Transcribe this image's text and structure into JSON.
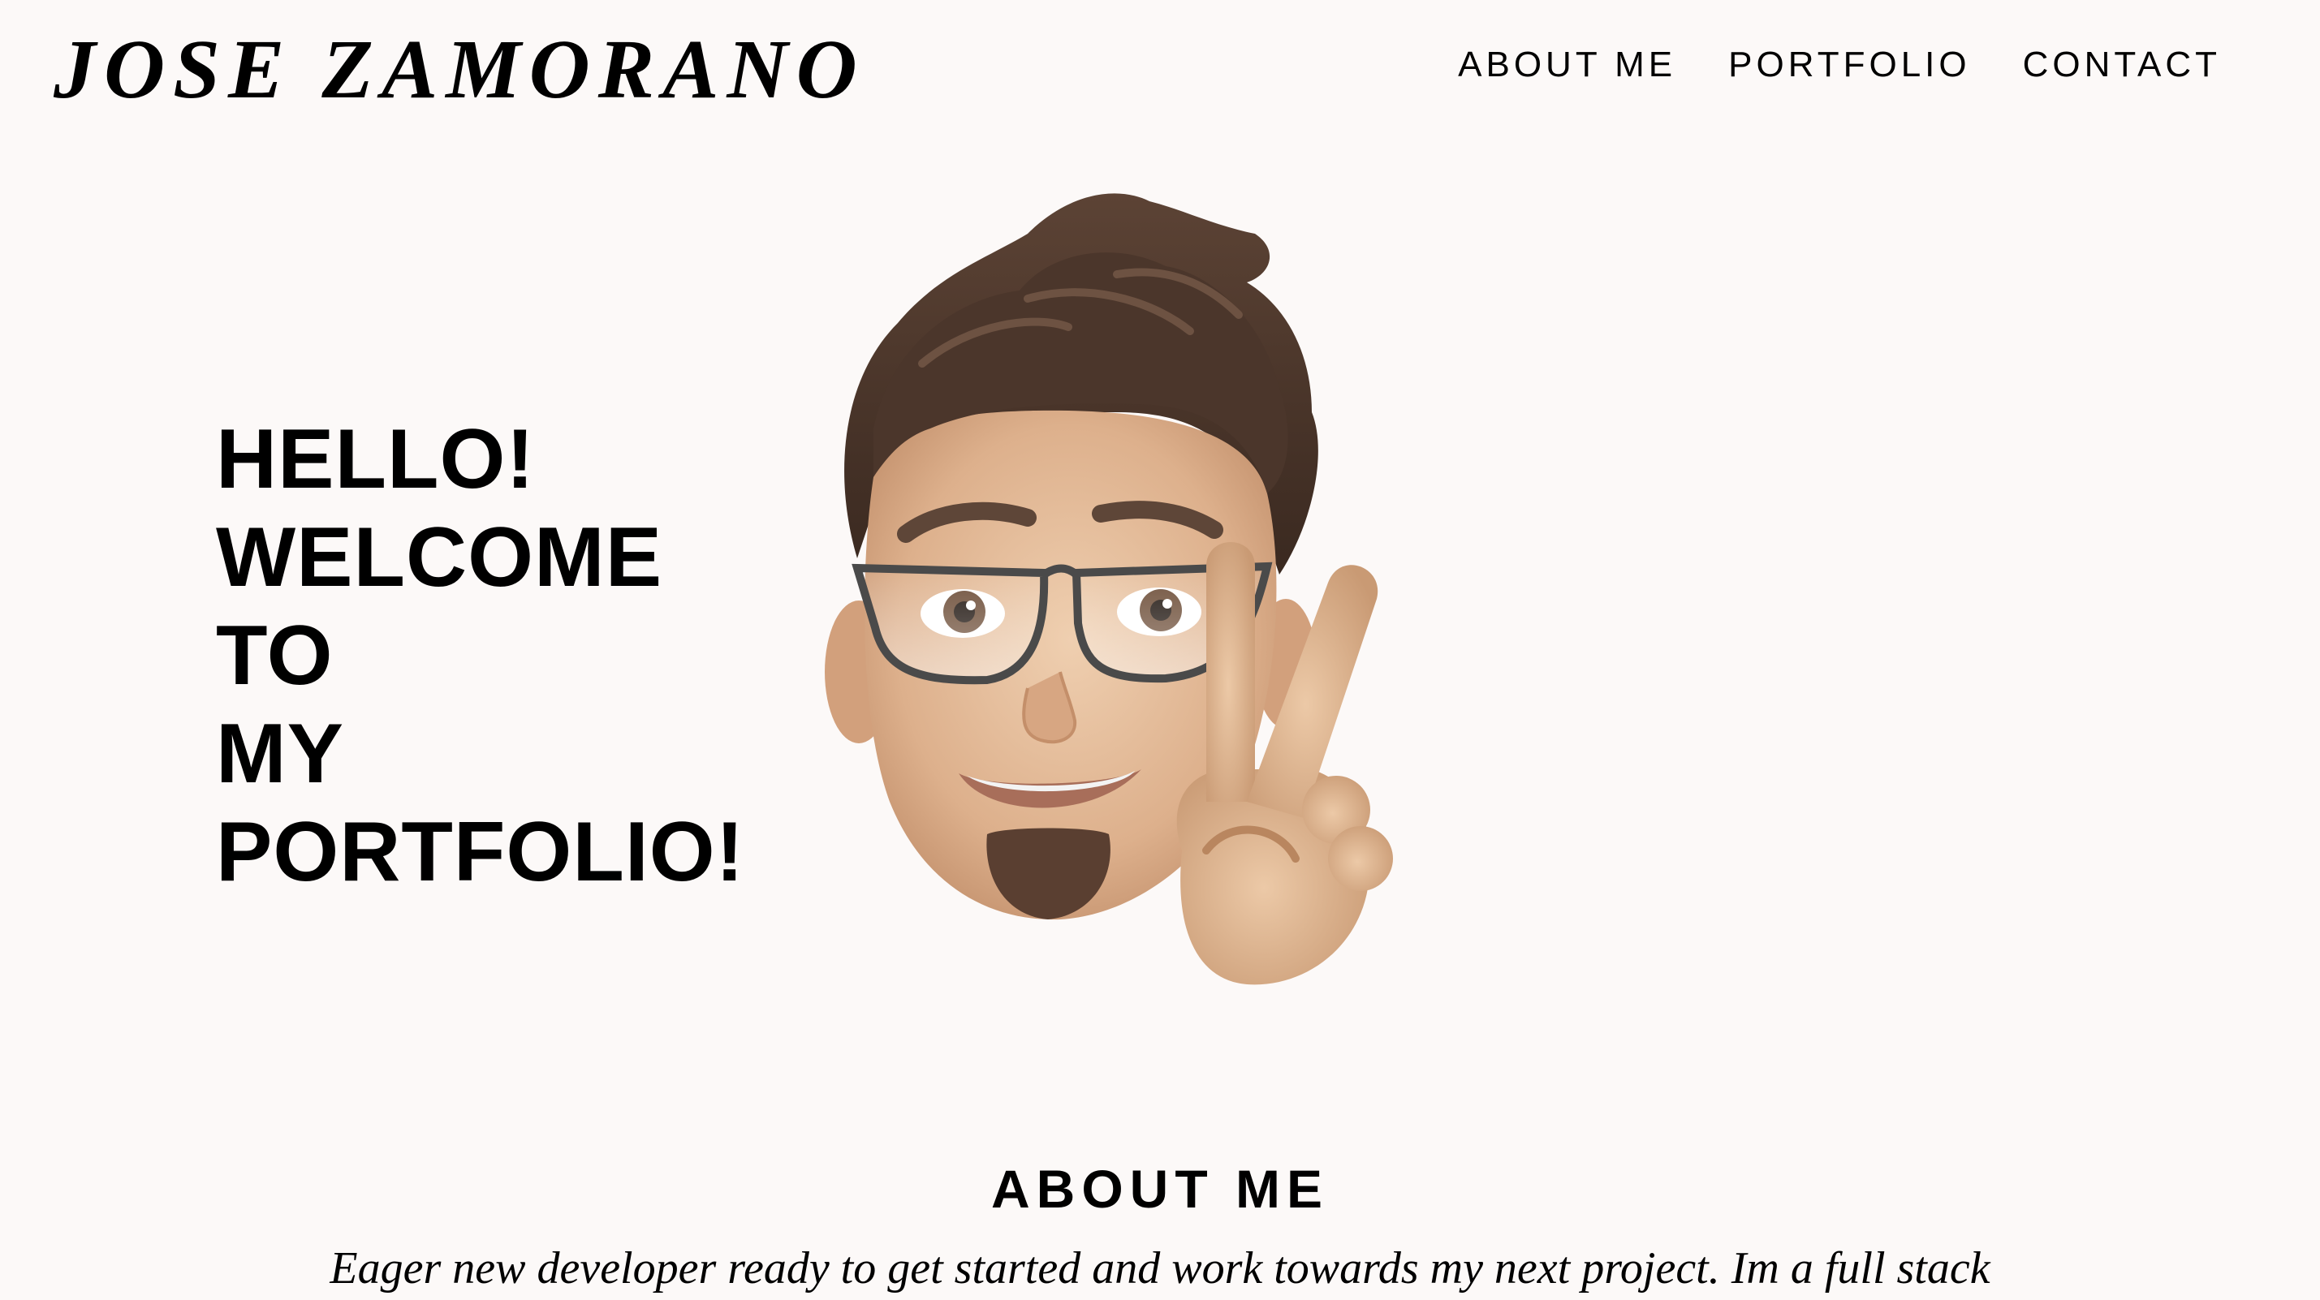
{
  "header": {
    "logo_text": "JOSE ZAMORANO",
    "nav": [
      {
        "label": "ABOUT ME"
      },
      {
        "label": "PORTFOLIO"
      },
      {
        "label": "CONTACT"
      }
    ]
  },
  "hero": {
    "lines": [
      "HELLO!",
      "WELCOME",
      "TO",
      "MY",
      "PORTFOLIO!"
    ],
    "avatar_icon": "memoji-peace-sign-icon"
  },
  "about": {
    "title": "ABOUT ME",
    "text": "Eager new developer ready to get started and work towards my next project. Im a full stack"
  },
  "colors": {
    "background": "#fcf9f8",
    "text": "#000000"
  }
}
